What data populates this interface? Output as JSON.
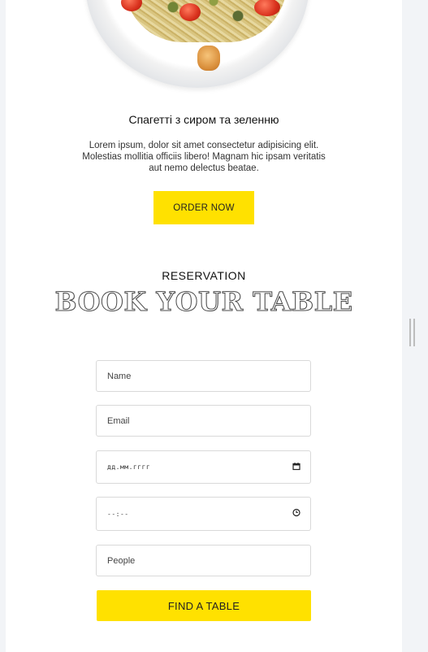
{
  "dish": {
    "title": "Спагетті з сиром та зеленню",
    "description": "Lorem ipsum, dolor sit amet consectetur adipisicing elit. Molestias mollitia officiis libero! Magnam hic ipsam veritatis aut nemo delectus beatae.",
    "order_label": "ORDER NOW"
  },
  "reservation": {
    "eyebrow": "RESERVATION",
    "heading": "BOOK YOUR TABLE",
    "name_placeholder": "Name",
    "email_placeholder": "Email",
    "date_placeholder": "дд.мм.гггг",
    "time_placeholder": "--:--",
    "people_placeholder": "People",
    "submit_label": "FIND A TABLE"
  },
  "colors": {
    "accent": "#ffe100",
    "page_background": "#ffffff",
    "field_border": "#d9d9d9"
  },
  "icons": {
    "date_field": "calendar-icon",
    "time_field": "clock-icon"
  }
}
